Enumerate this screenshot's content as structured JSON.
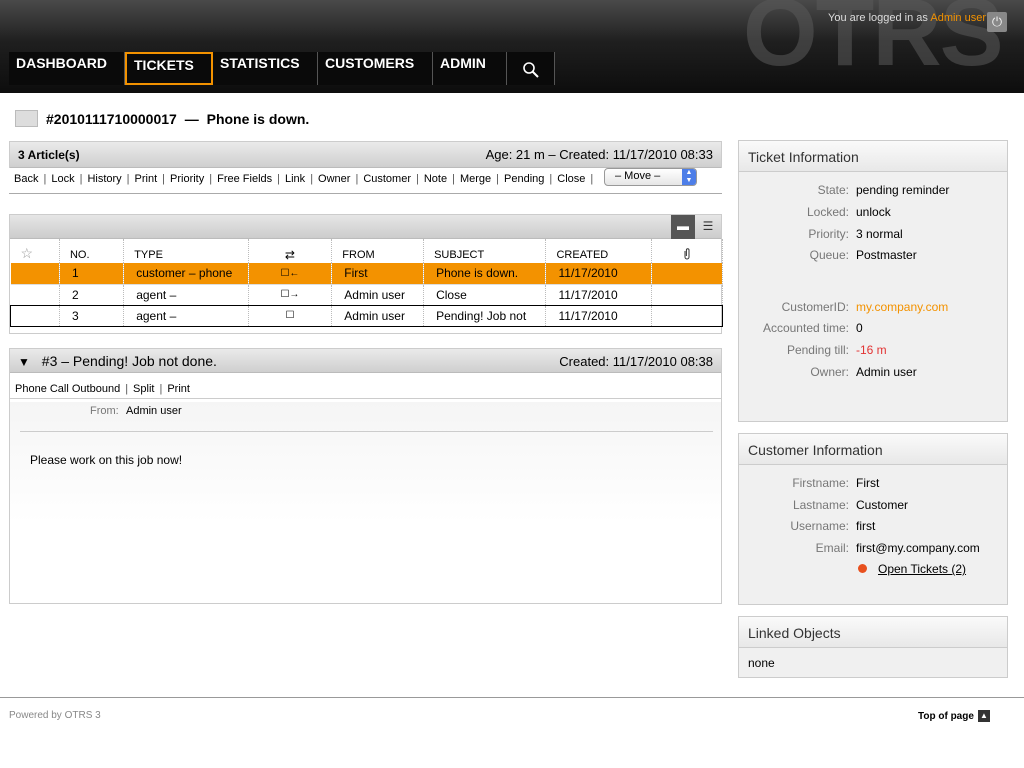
{
  "header": {
    "logo": "OTRS",
    "logged_in_prefix": "You are logged in as",
    "logged_in_user": "Admin user",
    "logout_icon": "power-icon",
    "nav": [
      {
        "label": "DASHBOARD"
      },
      {
        "label": "TICKETS"
      },
      {
        "label": "STATISTICS"
      },
      {
        "label": "CUSTOMERS"
      },
      {
        "label": "ADMIN"
      }
    ],
    "search_icon": "search-icon",
    "active_accent": "#f39200"
  },
  "ticket": {
    "number": "#2010111710000017",
    "separator": "—",
    "subject": "Phone is down."
  },
  "articles": {
    "count_label": "3 Article(s)",
    "age_created": "Age: 21 m – Created: 11/17/2010 08:33",
    "actions": [
      "Back",
      "Lock",
      "History",
      "Print",
      "Priority",
      "Free Fields",
      "Link",
      "Owner",
      "Customer",
      "Note",
      "Merge",
      "Pending",
      "Close"
    ],
    "move_select": "– Move –",
    "columns": [
      "NO.",
      "TYPE",
      "⇄",
      "FROM",
      "SUBJECT",
      "CREATED"
    ],
    "rows": [
      {
        "no": "1",
        "type": "customer – phone",
        "dir": "☐←",
        "from": "First",
        "subject": "Phone is down.",
        "created": "11/17/2010"
      },
      {
        "no": "2",
        "type": "agent –",
        "dir": "☐→",
        "from": "Admin user",
        "subject": "Close",
        "created": "11/17/2010"
      },
      {
        "no": "3",
        "type": "agent –",
        "dir": "☐",
        "from": "Admin user",
        "subject": "Pending! Job not",
        "created": "11/17/2010"
      }
    ]
  },
  "detail": {
    "title": "#3 – Pending! Job not done.",
    "created": "Created: 11/17/2010 08:38",
    "actions": [
      "Phone Call Outbound",
      "Split",
      "Print"
    ],
    "from_label": "From:",
    "from_value": "Admin user",
    "body": "Please work on this job now!"
  },
  "ticket_info": {
    "heading": "Ticket Information",
    "state_k": "State:",
    "state_v": "pending reminder",
    "locked_k": "Locked:",
    "locked_v": "unlock",
    "priority_k": "Priority:",
    "priority_v": "3 normal",
    "queue_k": "Queue:",
    "queue_v": "Postmaster",
    "customerid_k": "CustomerID:",
    "customerid_v": "my.company.com",
    "accounted_k": "Accounted time:",
    "accounted_v": "0",
    "pending_k": "Pending till:",
    "pending_v": "-16 m",
    "owner_k": "Owner:",
    "owner_v": "Admin user"
  },
  "customer_info": {
    "heading": "Customer Information",
    "firstname_k": "Firstname:",
    "firstname_v": "First",
    "lastname_k": "Lastname:",
    "lastname_v": "Customer",
    "username_k": "Username:",
    "username_v": "first",
    "email_k": "Email:",
    "email_v": "first@my.company.com",
    "open_tickets": "Open Tickets (2)"
  },
  "linked": {
    "heading": "Linked Objects",
    "value": "none"
  },
  "footer": {
    "powered": "Powered by OTRS 3",
    "top": "Top of page"
  }
}
